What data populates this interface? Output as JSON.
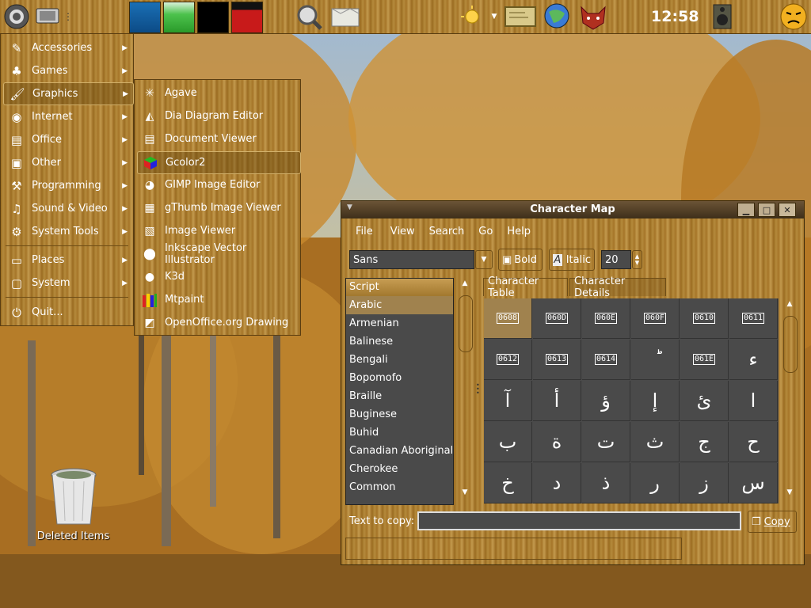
{
  "panel": {
    "clock": "12:58"
  },
  "menu": {
    "items": [
      {
        "label": "Accessories",
        "icon": "accessories-icon"
      },
      {
        "label": "Games",
        "icon": "games-icon"
      },
      {
        "label": "Graphics",
        "icon": "graphics-icon"
      },
      {
        "label": "Internet",
        "icon": "internet-icon"
      },
      {
        "label": "Office",
        "icon": "office-icon"
      },
      {
        "label": "Other",
        "icon": "other-icon"
      },
      {
        "label": "Programming",
        "icon": "programming-icon"
      },
      {
        "label": "Sound & Video",
        "icon": "sound-video-icon"
      },
      {
        "label": "System Tools",
        "icon": "system-tools-icon"
      }
    ],
    "places": "Places",
    "system": "System",
    "quit": "Quit..."
  },
  "submenu": {
    "items": [
      {
        "label": "Agave"
      },
      {
        "label": "Dia Diagram Editor"
      },
      {
        "label": "Document Viewer"
      },
      {
        "label": "Gcolor2"
      },
      {
        "label": "GIMP Image Editor"
      },
      {
        "label": "gThumb Image Viewer"
      },
      {
        "label": "Image Viewer"
      },
      {
        "label": "Inkscape Vector Illustrator"
      },
      {
        "label": "K3d"
      },
      {
        "label": "Mtpaint"
      },
      {
        "label": "OpenOffice.org Drawing"
      }
    ]
  },
  "desktop": {
    "trash_label": "Deleted Items"
  },
  "charmap": {
    "title": "Character Map",
    "menus": [
      "File",
      "View",
      "Search",
      "Go",
      "Help"
    ],
    "font": "Sans",
    "bold": "Bold",
    "italic": "Italic",
    "size": "20",
    "script_header": "Script",
    "scripts": [
      "Arabic",
      "Armenian",
      "Balinese",
      "Bengali",
      "Bopomofo",
      "Braille",
      "Buginese",
      "Buhid",
      "Canadian Aboriginal",
      "Cherokee",
      "Common"
    ],
    "tab_table": "Character Table",
    "tab_details": "Character Details",
    "text_to_copy_label": "Text to copy:",
    "text_to_copy_value": "",
    "copy": "Copy",
    "cells": [
      {
        "hex": "0608"
      },
      {
        "hex": "060D"
      },
      {
        "hex": "060E"
      },
      {
        "hex": "060F"
      },
      {
        "hex": "0610"
      },
      {
        "hex": "0611"
      },
      {
        "hex": "0612"
      },
      {
        "hex": "0613"
      },
      {
        "hex": "0614"
      },
      {
        "glyph": "ؕ"
      },
      {
        "hex": "061E"
      },
      {
        "glyph": "ء"
      },
      {
        "glyph": "آ"
      },
      {
        "glyph": "أ"
      },
      {
        "glyph": "ؤ"
      },
      {
        "glyph": "إ"
      },
      {
        "glyph": "ئ"
      },
      {
        "glyph": "ا"
      },
      {
        "glyph": "ب"
      },
      {
        "glyph": "ة"
      },
      {
        "glyph": "ت"
      },
      {
        "glyph": "ث"
      },
      {
        "glyph": "ج"
      },
      {
        "glyph": "ح"
      },
      {
        "glyph": "خ"
      },
      {
        "glyph": "د"
      },
      {
        "glyph": "ذ"
      },
      {
        "glyph": "ر"
      },
      {
        "glyph": "ز"
      },
      {
        "glyph": "س"
      }
    ]
  }
}
